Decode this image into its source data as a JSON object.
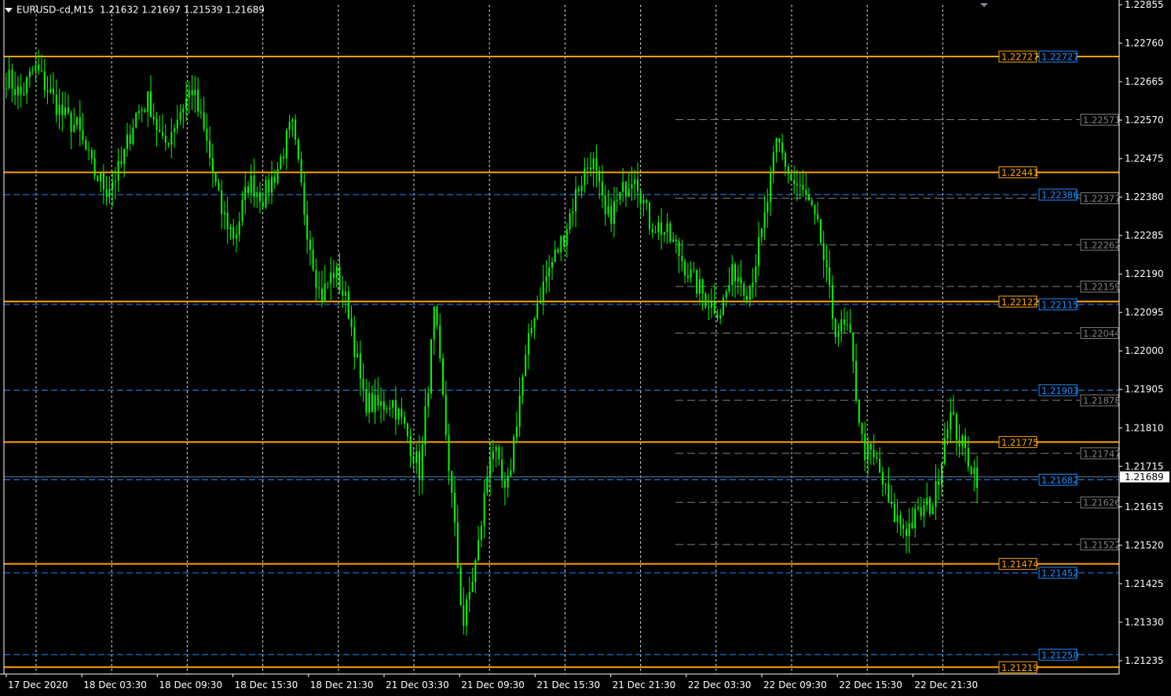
{
  "header": {
    "symbol": "EURUSD-cd,M15",
    "ohlc": "1.21632 1.21697 1.21539 1.21689"
  },
  "colors": {
    "background": "#000000",
    "candle": "#00ff00",
    "axis": "#ffffff",
    "grid": "#ffffff",
    "support_resistance": "#ffa500",
    "blue_level": "#1e90ff",
    "gray_level": "#808080",
    "current_price_line": "#5f7f9f"
  },
  "chart_data": {
    "type": "candlestick",
    "symbol": "EURUSD-cd",
    "timeframe": "M15",
    "y_ticks": [
      "1.22855",
      "1.22760",
      "1.22665",
      "1.22570",
      "1.22475",
      "1.22380",
      "1.22285",
      "1.22190",
      "1.22095",
      "1.22000",
      "1.21905",
      "1.21810",
      "1.21715",
      "1.21615",
      "1.21520",
      "1.21425",
      "1.21330",
      "1.21235"
    ],
    "ylim": [
      1.2121,
      1.2286
    ],
    "x_ticks": [
      "17 Dec 2020",
      "18 Dec 03:30",
      "18 Dec 09:30",
      "18 Dec 15:30",
      "18 Dec 21:30",
      "21 Dec 03:30",
      "21 Dec 09:30",
      "21 Dec 15:30",
      "21 Dec 21:30",
      "22 Dec 03:30",
      "22 Dec 09:30",
      "22 Dec 15:30",
      "22 Dec 21:30"
    ],
    "current_price": "1.21689",
    "orange_levels": [
      "1.22727",
      "1.22441",
      "1.22122",
      "1.21775",
      "1.21474",
      "1.21219"
    ],
    "blue_levels": [
      "1.22727",
      "1.22386",
      "1.22115",
      "1.21903",
      "1.21682",
      "1.21452",
      "1.21250"
    ],
    "gray_levels": [
      "1.22571",
      "1.22377",
      "1.22262",
      "1.22159",
      "1.22044",
      "1.21878",
      "1.21747",
      "1.21626",
      "1.21522"
    ],
    "price_path": [
      {
        "t": "17 Dec 2020",
        "p": 1.2268
      },
      {
        "t": "17 Dec 2020",
        "p": 1.2263
      },
      {
        "t": "17 Dec 2020",
        "p": 1.227
      },
      {
        "t": "17 Dec 2020",
        "p": 1.2264
      },
      {
        "t": "17 Dec 2020",
        "p": 1.2258
      },
      {
        "t": "18 Dec 03:30",
        "p": 1.2255
      },
      {
        "t": "18 Dec 03:30",
        "p": 1.2245
      },
      {
        "t": "18 Dec 03:30",
        "p": 1.224
      },
      {
        "t": "18 Dec 03:30",
        "p": 1.2245
      },
      {
        "t": "18 Dec 09:30",
        "p": 1.2258
      },
      {
        "t": "18 Dec 09:30",
        "p": 1.2262
      },
      {
        "t": "18 Dec 09:30",
        "p": 1.225
      },
      {
        "t": "18 Dec 09:30",
        "p": 1.2258
      },
      {
        "t": "18 Dec 15:30",
        "p": 1.2265
      },
      {
        "t": "18 Dec 15:30",
        "p": 1.2252
      },
      {
        "t": "18 Dec 15:30",
        "p": 1.2235
      },
      {
        "t": "18 Dec 15:30",
        "p": 1.2228
      },
      {
        "t": "18 Dec 15:30",
        "p": 1.2242
      },
      {
        "t": "18 Dec 21:30",
        "p": 1.2238
      },
      {
        "t": "18 Dec 21:30",
        "p": 1.2245
      },
      {
        "t": "18 Dec 21:30",
        "p": 1.2256
      },
      {
        "t": "21 Dec 03:30",
        "p": 1.2232
      },
      {
        "t": "21 Dec 03:30",
        "p": 1.2213
      },
      {
        "t": "21 Dec 03:30",
        "p": 1.222
      },
      {
        "t": "21 Dec 03:30",
        "p": 1.221
      },
      {
        "t": "21 Dec 03:30",
        "p": 1.2188
      },
      {
        "t": "21 Dec 03:30",
        "p": 1.2186
      },
      {
        "t": "21 Dec 09:30",
        "p": 1.2188
      },
      {
        "t": "21 Dec 09:30",
        "p": 1.218
      },
      {
        "t": "21 Dec 09:30",
        "p": 1.217
      },
      {
        "t": "21 Dec 09:30",
        "p": 1.221
      },
      {
        "t": "21 Dec 09:30",
        "p": 1.2172
      },
      {
        "t": "21 Dec 09:30",
        "p": 1.2132
      },
      {
        "t": "21 Dec 09:30",
        "p": 1.215
      },
      {
        "t": "21 Dec 09:30",
        "p": 1.2178
      },
      {
        "t": "21 Dec 09:30",
        "p": 1.2163
      },
      {
        "t": "21 Dec 15:30",
        "p": 1.219
      },
      {
        "t": "21 Dec 15:30",
        "p": 1.221
      },
      {
        "t": "21 Dec 15:30",
        "p": 1.222
      },
      {
        "t": "21 Dec 15:30",
        "p": 1.2228
      },
      {
        "t": "21 Dec 15:30",
        "p": 1.224
      },
      {
        "t": "21 Dec 21:30",
        "p": 1.2248
      },
      {
        "t": "21 Dec 21:30",
        "p": 1.2232
      },
      {
        "t": "21 Dec 21:30",
        "p": 1.2238
      },
      {
        "t": "21 Dec 21:30",
        "p": 1.2245
      },
      {
        "t": "22 Dec 03:30",
        "p": 1.2232
      },
      {
        "t": "22 Dec 03:30",
        "p": 1.223
      },
      {
        "t": "22 Dec 03:30",
        "p": 1.2225
      },
      {
        "t": "22 Dec 03:30",
        "p": 1.2218
      },
      {
        "t": "22 Dec 03:30",
        "p": 1.2213
      },
      {
        "t": "22 Dec 09:30",
        "p": 1.221
      },
      {
        "t": "22 Dec 09:30",
        "p": 1.222
      },
      {
        "t": "22 Dec 09:30",
        "p": 1.2215
      },
      {
        "t": "22 Dec 09:30",
        "p": 1.223
      },
      {
        "t": "22 Dec 09:30",
        "p": 1.2252
      },
      {
        "t": "22 Dec 09:30",
        "p": 1.2242
      },
      {
        "t": "22 Dec 09:30",
        "p": 1.2238
      },
      {
        "t": "22 Dec 15:30",
        "p": 1.2228
      },
      {
        "t": "22 Dec 15:30",
        "p": 1.2206
      },
      {
        "t": "22 Dec 15:30",
        "p": 1.2205
      },
      {
        "t": "22 Dec 15:30",
        "p": 1.2176
      },
      {
        "t": "22 Dec 15:30",
        "p": 1.2172
      },
      {
        "t": "22 Dec 15:30",
        "p": 1.216
      },
      {
        "t": "22 Dec 15:30",
        "p": 1.2156
      },
      {
        "t": "22 Dec 21:30",
        "p": 1.216
      },
      {
        "t": "22 Dec 21:30",
        "p": 1.2163
      },
      {
        "t": "22 Dec 21:30",
        "p": 1.2185
      },
      {
        "t": "22 Dec 21:30",
        "p": 1.2176
      },
      {
        "t": "22 Dec 21:30",
        "p": 1.2169
      }
    ]
  }
}
